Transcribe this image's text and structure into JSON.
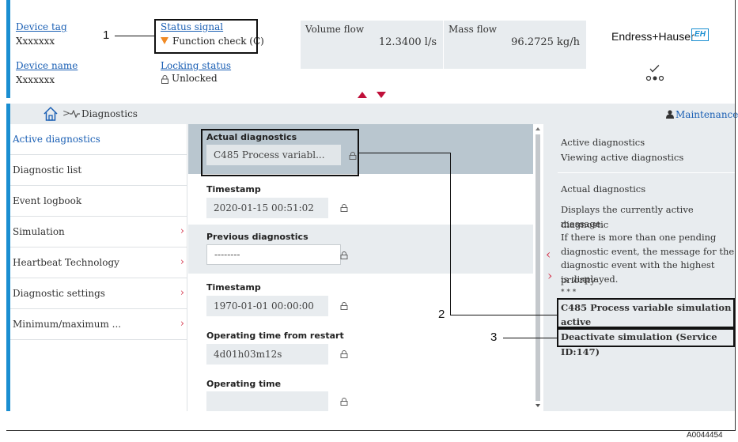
{
  "header": {
    "device_tag": {
      "label": "Device tag",
      "value": "Xxxxxxx"
    },
    "status_signal": {
      "label": "Status signal",
      "value": "Function check (C)"
    },
    "device_name": {
      "label": "Device name",
      "value": "Xxxxxxx"
    },
    "locking_status": {
      "label": "Locking status",
      "value": "Unlocked"
    },
    "volume_flow": {
      "label": "Volume flow",
      "value": "12.3400 l/s"
    },
    "mass_flow": {
      "label": "Mass flow",
      "value": "96.2725 kg/h"
    },
    "brand": "Endress+Hauser",
    "brand_logo": "EH"
  },
  "navbar": {
    "breadcrumb": "Diagnostics",
    "separator": ">",
    "user_role": "Maintenance"
  },
  "sidebar": {
    "items": [
      {
        "label": "Active diagnostics",
        "has_submenu": false,
        "active": true
      },
      {
        "label": "Diagnostic list",
        "has_submenu": false
      },
      {
        "label": "Event logbook",
        "has_submenu": false
      },
      {
        "label": "Simulation",
        "has_submenu": true
      },
      {
        "label": "Heartbeat Technology",
        "has_submenu": true
      },
      {
        "label": "Diagnostic settings",
        "has_submenu": true
      },
      {
        "label": "Minimum/maximum ...",
        "has_submenu": true
      }
    ]
  },
  "main": {
    "sections": [
      {
        "title": "Actual diagnostics",
        "value": "C485 Process variabl..."
      },
      {
        "title": "Timestamp",
        "value": "2020-01-15 00:51:02"
      },
      {
        "title": "Previous diagnostics",
        "value": "--------"
      },
      {
        "title": "Timestamp",
        "value": "1970-01-01 00:00:00"
      },
      {
        "title": "Operating time from restart",
        "value": "4d01h03m12s"
      },
      {
        "title": "Operating time",
        "value": ""
      }
    ]
  },
  "help": {
    "title": "Active diagnostics",
    "subtitle": "Viewing active diagnostics",
    "param_title": "Actual diagnostics",
    "desc_1": "Displays the currently active diagnostic",
    "desc_2": "message.",
    "desc_3": "If there is more than one pending",
    "desc_4": "diagnostic event, the message for the",
    "desc_5": "diagnostic event with the highest priority",
    "desc_6": "is displayed.",
    "stars": "* * *",
    "event_1": "C485 Process variable simulation",
    "event_2": "active",
    "remedy": "Deactivate simulation (Service ID:147)"
  },
  "callouts": [
    "1",
    "2",
    "3"
  ],
  "figure_id": "A0044454",
  "icons": [
    "home-icon",
    "heartbeat-icon",
    "user-icon",
    "lock-icon",
    "warning-triangle-icon",
    "chevron-right-icon",
    "chevron-left-icon",
    "collapse-up-icon",
    "expand-down-icon",
    "connection-status-icon"
  ],
  "colors": {
    "accent_blue": "#1a8ed1",
    "link_blue": "#1a5fb4",
    "chevron_red": "#d4344b",
    "status_orange": "#f08a24",
    "panel_grey": "#e8ecef",
    "selected_band": "#b9c6cf"
  }
}
